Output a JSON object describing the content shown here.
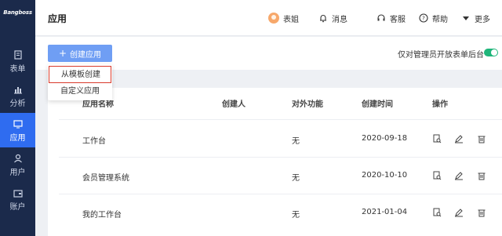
{
  "sidebar": {
    "logo": "Bangboss",
    "items": [
      {
        "label": "表单",
        "icon": "form-icon",
        "active": false
      },
      {
        "label": "分析",
        "icon": "chart-icon",
        "active": false
      },
      {
        "label": "应用",
        "icon": "app-icon",
        "active": true
      },
      {
        "label": "用户",
        "icon": "user-icon",
        "active": false
      },
      {
        "label": "账户",
        "icon": "wallet-icon",
        "active": false
      }
    ]
  },
  "header": {
    "title": "应用",
    "user_name": "表姐",
    "messages": "消息",
    "support": "客服",
    "help": "帮助",
    "more": "更多"
  },
  "toolbar": {
    "create_button": "创建应用",
    "toggle_label": "仅对管理员开放表单后台",
    "toggle_on": true
  },
  "dropdown": {
    "items": [
      "从模板创建",
      "自定义应用"
    ]
  },
  "table": {
    "columns": [
      "应用名称",
      "创建人",
      "对外功能",
      "创建时间",
      "操作"
    ],
    "rows": [
      {
        "name": "工作台",
        "creator": "",
        "external": "无",
        "created": "2020-09-18"
      },
      {
        "name": "会员管理系统",
        "creator": "",
        "external": "无",
        "created": "2020-10-10"
      },
      {
        "name": "我的工作台",
        "creator": "",
        "external": "无",
        "created": "2021-01-04"
      }
    ]
  },
  "colors": {
    "sidebar_bg": "#1b2a4b",
    "accent": "#2f6cf0",
    "button": "#6f9ef4",
    "toggle_on": "#1fb57a",
    "highlight_border": "#d93a2b"
  }
}
